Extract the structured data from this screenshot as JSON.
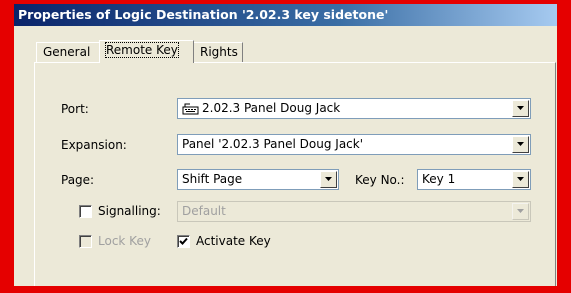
{
  "window": {
    "title": "Properties of Logic Destination '2.02.3 key sidetone'"
  },
  "tabs": [
    {
      "label": "General",
      "active": false
    },
    {
      "label": "Remote Key",
      "active": true
    },
    {
      "label": "Rights",
      "active": false
    }
  ],
  "form": {
    "port_label": "Port:",
    "port_value": "2.02.3 Panel Doug Jack",
    "expansion_label": "Expansion:",
    "expansion_value": "Panel '2.02.3 Panel Doug Jack'",
    "page_label": "Page:",
    "page_value": "Shift Page",
    "keyno_label": "Key No.:",
    "keyno_value": "Key 1",
    "signalling_label": "Signalling:",
    "signalling_checked": false,
    "signalling_value": "Default",
    "lockkey_label": "Lock Key",
    "lockkey_checked": false,
    "activatekey_label": "Activate Key",
    "activatekey_checked": true
  },
  "colors": {
    "frame": "#e50000",
    "titlebar": "#0a246a"
  },
  "icons": [
    "keyboard-icon",
    "dropdown-arrow-icon",
    "checkmark-icon"
  ]
}
